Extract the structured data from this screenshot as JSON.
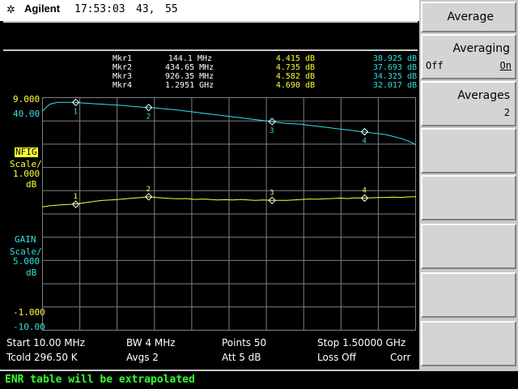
{
  "status": {
    "logo_glyph": "✲",
    "brand": "Agilent",
    "time": "17:53:03",
    "num1": "43,",
    "num2": "55"
  },
  "markers": [
    {
      "name": "Mkr1",
      "freq": "144.1 MHz",
      "nf": "4.415 dB",
      "gain": "38.925 dB"
    },
    {
      "name": "Mkr2",
      "freq": "434.65 MHz",
      "nf": "4.735 dB",
      "gain": "37.693 dB"
    },
    {
      "name": "Mkr3",
      "freq": "926.35 MHz",
      "nf": "4.582 dB",
      "gain": "34.325 dB"
    },
    {
      "name": "Mkr4",
      "freq": "1.2951 GHz",
      "nf": "4.690 dB",
      "gain": "32.017 dB"
    }
  ],
  "axis": {
    "nf_top": "9.000",
    "gain_top": "40.00",
    "nfig_title": "NFIG",
    "nf_scale_label": "Scale/",
    "nf_scale": "1.000",
    "nf_unit": "dB",
    "gain_title": "GAIN",
    "gain_scale_label": "Scale/",
    "gain_scale": "5.000",
    "gain_unit": "dB",
    "nf_bottom": "-1.000",
    "gain_bottom": "-10.00"
  },
  "info": {
    "start": "Start 10.00 MHz",
    "bw": "BW 4 MHz",
    "points": "Points 50",
    "stop": "Stop 1.50000 GHz",
    "tcold": "Tcold 296.50 K",
    "avgs": "Avgs 2",
    "att": "Att 5 dB",
    "loss": "Loss Off",
    "corr": "Corr"
  },
  "message": "ENR table will be extrapolated",
  "softkeys": {
    "title": "Average",
    "averaging": {
      "label": "Averaging",
      "off": "Off",
      "on": "On"
    },
    "averages": {
      "label": "Averages",
      "value": "2"
    }
  },
  "colors": {
    "nf_trace": "#ffff33",
    "gain_trace": "#33e0e0",
    "grid": "#808080",
    "message": "#33ff33"
  },
  "chart_data": {
    "type": "line",
    "x_label": "",
    "xlim_mhz": [
      10,
      1500
    ],
    "x_points": 50,
    "marker_x_mhz": [
      144.1,
      434.65,
      926.35,
      1295.1
    ],
    "series": [
      {
        "name": "NFIG",
        "unit": "dB",
        "ylim": [
          -1,
          9
        ],
        "values": [
          4.3,
          4.35,
          4.38,
          4.4,
          4.415,
          4.45,
          4.5,
          4.55,
          4.58,
          4.6,
          4.62,
          4.65,
          4.68,
          4.7,
          4.735,
          4.7,
          4.68,
          4.66,
          4.65,
          4.66,
          4.62,
          4.64,
          4.62,
          4.6,
          4.61,
          4.6,
          4.62,
          4.6,
          4.58,
          4.6,
          4.58,
          4.58,
          4.582,
          4.6,
          4.62,
          4.64,
          4.63,
          4.65,
          4.66,
          4.68,
          4.66,
          4.69,
          4.68,
          4.69,
          4.7,
          4.71,
          4.72,
          4.71,
          4.73,
          4.74
        ]
      },
      {
        "name": "GAIN",
        "unit": "dB",
        "ylim": [
          -10,
          40
        ],
        "values": [
          37.0,
          38.5,
          38.9,
          38.925,
          38.9,
          38.8,
          38.7,
          38.6,
          38.5,
          38.4,
          38.3,
          38.2,
          38.0,
          37.9,
          37.8,
          37.693,
          37.5,
          37.4,
          37.2,
          37.0,
          36.8,
          36.6,
          36.4,
          36.2,
          36.0,
          35.8,
          35.6,
          35.4,
          35.2,
          35.0,
          34.8,
          34.6,
          34.4,
          34.325,
          34.2,
          34.0,
          33.8,
          33.6,
          33.4,
          33.2,
          33.0,
          32.8,
          32.6,
          32.4,
          32.2,
          32.017,
          31.6,
          31.2,
          30.6,
          29.8
        ]
      }
    ]
  }
}
